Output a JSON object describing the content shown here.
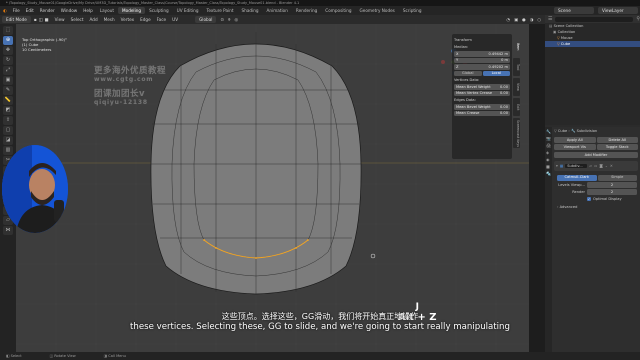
{
  "window": {
    "title": "* /Topology_Study_Mouse01/GoogleDrive/My Drive/UM3D_Tutorials/Topology_Master_Class/Course/Topology_Master_Class/Topology_Study_Mouse01.blend - Blender 4.1"
  },
  "menubar": {
    "items": [
      "File",
      "Edit",
      "Render",
      "Window",
      "Help"
    ],
    "workspaces": [
      "Layout",
      "Modeling",
      "Sculpting",
      "UV Editing",
      "Texture Paint",
      "Shading",
      "Animation",
      "Rendering",
      "Compositing",
      "Geometry Nodes",
      "Scripting"
    ],
    "active_workspace": "Modeling",
    "scene_label": "Scene",
    "viewlayer_label": "ViewLayer"
  },
  "toolbar": {
    "mode": "Edit Mode",
    "menus": [
      "View",
      "Select",
      "Add",
      "Mesh",
      "Vertex",
      "Edge",
      "Face",
      "UV"
    ],
    "transform_orientation": "Global",
    "options_label": "Options"
  },
  "viewport": {
    "hud_view": "Top Orthographic (-90)°",
    "hud_object": "(1) Cube",
    "hud_scale": "10 Centimeters",
    "watermark": [
      "更多海外优质教程",
      "www.cgtg.com",
      "团课加团长v",
      "qiqiyu-12138"
    ]
  },
  "npanel": {
    "header": "Transform",
    "median_label": "Median:",
    "coords": [
      {
        "axis": "X",
        "value": "0.49442 m"
      },
      {
        "axis": "Y",
        "value": "0 m"
      },
      {
        "axis": "Z",
        "value": "0.49202 m"
      }
    ],
    "space_options": [
      "Global",
      "Local"
    ],
    "active_space": "Local",
    "vertices_data_label": "Vertices Data:",
    "vertices_rows": [
      {
        "label": "Mean Bevel Weight",
        "value": "0.00"
      },
      {
        "label": "Mean Vertex Crease",
        "value": "0.00"
      }
    ],
    "edges_data_label": "Edges Data:",
    "edges_rows": [
      {
        "label": "Mean Bevel Weight",
        "value": "0.00"
      },
      {
        "label": "Mean Crease",
        "value": "0.00"
      }
    ],
    "tabs": [
      "Item",
      "Tool",
      "View",
      "Edit",
      "Screencast Keys"
    ]
  },
  "outliner": {
    "rows": [
      "Scene Collection",
      "Collection",
      "Mouse",
      "Cube"
    ],
    "selected": "Cube"
  },
  "properties": {
    "breadcrumb_object": "Cube",
    "breadcrumb_modifier": "Subdivision",
    "buttons": [
      "Apply All",
      "Delete All",
      "Viewport Vis",
      "Toggle Stack"
    ],
    "add_modifier": "Add Modifier",
    "modifier_name": "Subdiv...",
    "algo_options": [
      "Catmull-Clark",
      "Simple"
    ],
    "active_algo": "Catmull-Clark",
    "levels_viewport_label": "Levels Viewp...",
    "levels_viewport_value": "2",
    "render_label": "Render",
    "render_value": "2",
    "optimal_display": "Optimal Display",
    "advanced": "Advanced"
  },
  "statusbar": {
    "items": [
      "Select",
      "Rotate View",
      "Call Menu"
    ]
  },
  "overlay": {
    "keys": [
      "J",
      "Alt + Z"
    ],
    "subtitle_cn": "这些顶点。选择这些，GG滑动，我们将开始真正地操作",
    "subtitle_en": "these vertices. Selecting these, GG to slide, and we're going to start really manipulating"
  },
  "colors": {
    "accent": "#4772b3",
    "selected_edge": "#f5a623",
    "mesh_face": "#7a7a7a",
    "viewport_bg": "#3d3d3d"
  }
}
